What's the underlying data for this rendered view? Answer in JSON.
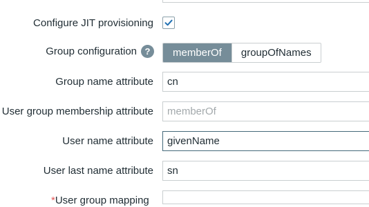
{
  "form": {
    "jit": {
      "label": "Configure JIT provisioning",
      "checked": true
    },
    "group_configuration": {
      "label": "Group configuration",
      "help_icon": "question-mark-icon",
      "help_glyph": "?",
      "options": [
        "memberOf",
        "groupOfNames"
      ],
      "selected": "memberOf"
    },
    "group_name_attribute": {
      "label": "Group name attribute",
      "value": "cn"
    },
    "user_group_membership_attribute": {
      "label": "User group membership attribute",
      "value": "",
      "placeholder": "memberOf"
    },
    "user_name_attribute": {
      "label": "User name attribute",
      "value": "givenName"
    },
    "user_last_name_attribute": {
      "label": "User last name attribute",
      "value": "sn"
    },
    "user_group_mapping": {
      "required_marker": "*",
      "label": "User group mapping"
    }
  },
  "colors": {
    "accent": "#768d99",
    "checkmark": "#1f6fb2",
    "border": "#c9ced0",
    "focus_border": "#44697a",
    "required": "#e45959"
  }
}
